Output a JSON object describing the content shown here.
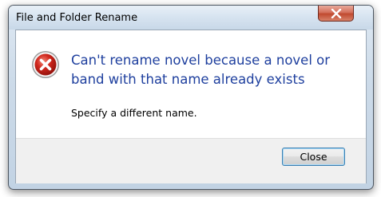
{
  "window": {
    "title": "File and Folder Rename",
    "close_icon": "close-x-icon"
  },
  "message": {
    "icon": "error-icon",
    "main_instruction": "Can't rename novel because a novel or band with that name already exists",
    "content": "Specify a different name."
  },
  "buttons": {
    "close_label": "Close"
  },
  "colors": {
    "instruction_text": "#1e3f9e",
    "error_red": "#d0271d",
    "close_button_red": "#c04a30"
  }
}
